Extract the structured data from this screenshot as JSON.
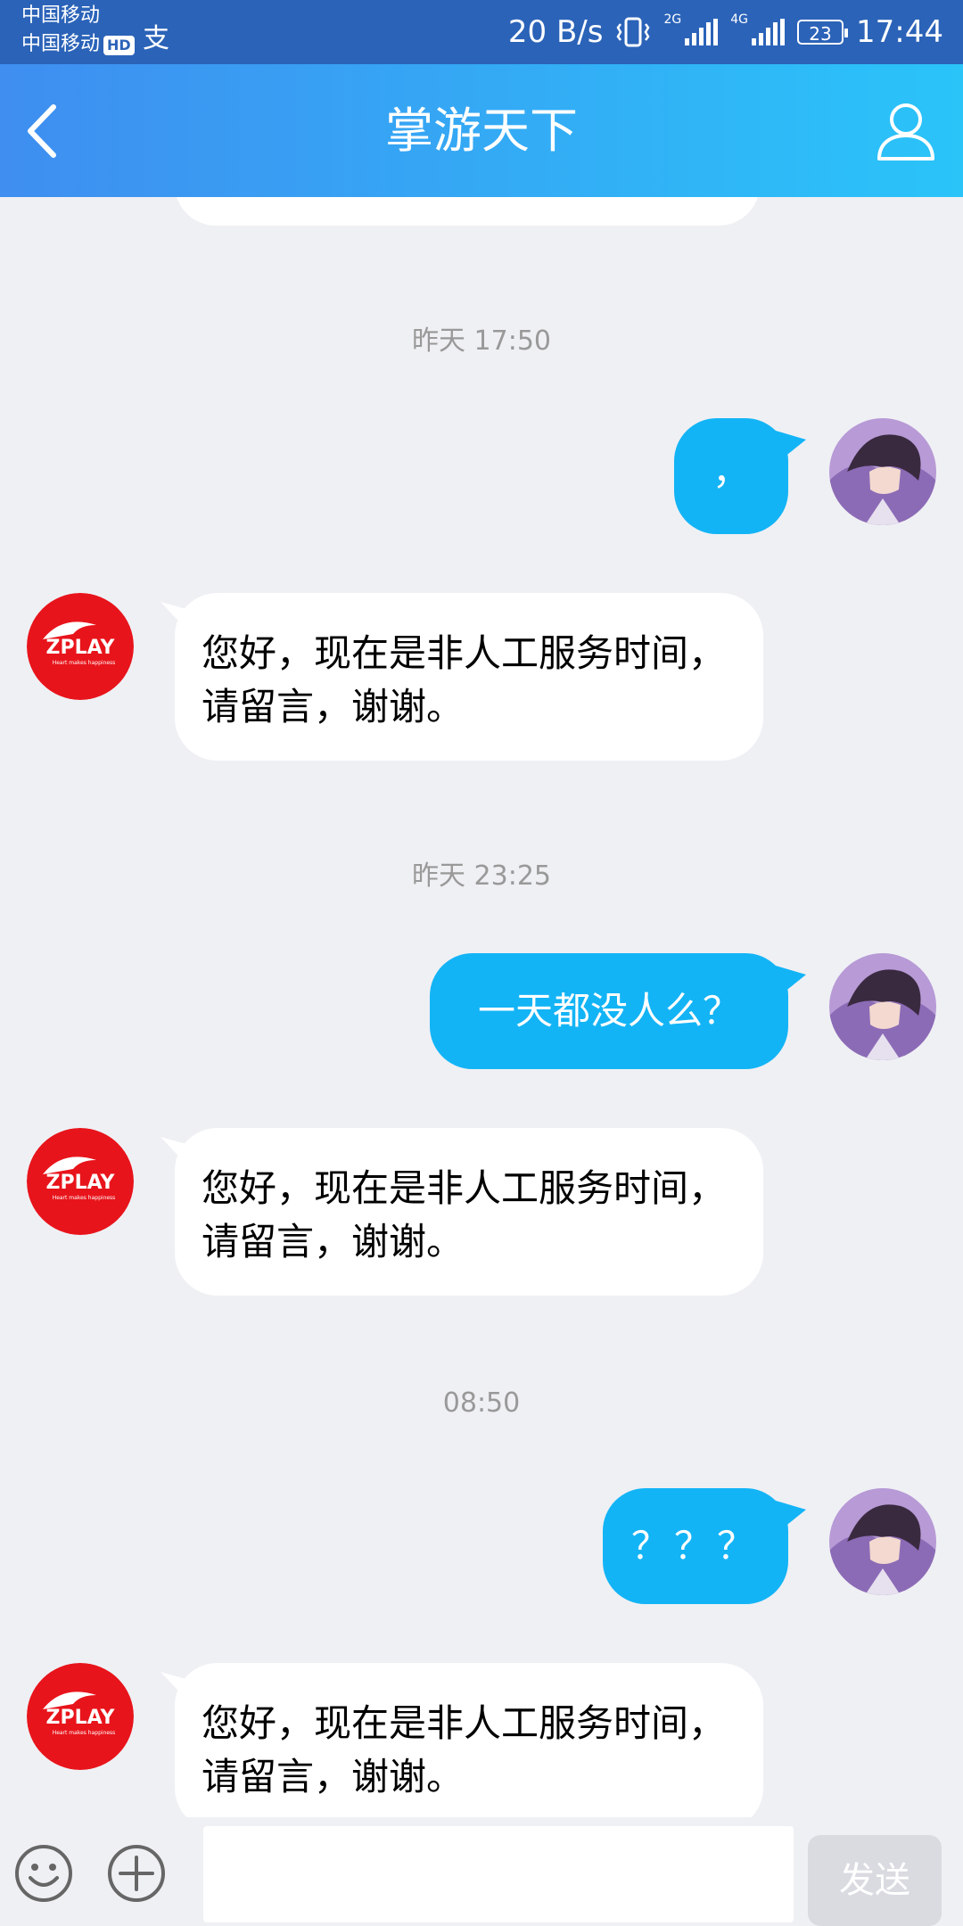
{
  "status": {
    "carrier1": "中国移动",
    "carrier2": "中国移动",
    "hd": "HD",
    "alipay": "支",
    "net_speed": "20 B/s",
    "net2": "2G",
    "net4": "4G",
    "battery": "23",
    "time": "17:44"
  },
  "header": {
    "title": "掌游天下"
  },
  "messages": {
    "ts1": "昨天 17:50",
    "m1_out": "，",
    "m1_in": "您好，现在是非人工服务时间，请留言，谢谢。",
    "ts2": "昨天 23:25",
    "m2_out": "一天都没人么？",
    "m2_in": "您好，现在是非人工服务时间，请留言，谢谢。",
    "ts3": "08:50",
    "m3_out": "？？？",
    "m3_in": "您好，现在是非人工服务时间，请留言，谢谢。"
  },
  "bot_avatar": {
    "logo_text": "ZPLAY",
    "tagline": "Heart makes happiness"
  },
  "input": {
    "send_label": "发送",
    "placeholder": ""
  }
}
